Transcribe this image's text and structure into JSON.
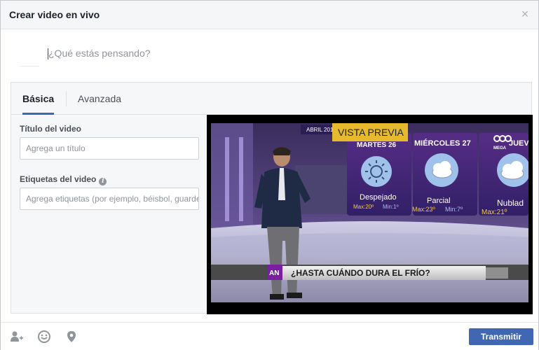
{
  "dialog": {
    "title": "Crear video en vivo",
    "close_glyph": "×"
  },
  "composer": {
    "placeholder": "¿Qué estás pensando?"
  },
  "tabs": [
    {
      "label": "Básica",
      "active": true
    },
    {
      "label": "Avanzada",
      "active": false
    }
  ],
  "form": {
    "title_label": "Título del video",
    "title_placeholder": "Agrega un título",
    "tags_label": "Etiquetas del video",
    "tags_placeholder": "Agrega etiquetas (por ejemplo, béisbol, guarde",
    "info_glyph": "i"
  },
  "preview": {
    "badge": "VISTA PREVIA",
    "month_tag": "ABRIL 201",
    "days": [
      {
        "name": "MARTES 26",
        "condition": "Despejado",
        "max": "Max:20º",
        "min": "Min:1º",
        "icon": "sun-icon"
      },
      {
        "name": "MIÉRCOLES 27",
        "condition": "Parcial",
        "max": "Max:23º",
        "min": "Min:7º",
        "icon": "partly-cloudy-icon"
      },
      {
        "name": "JUEVES",
        "condition": "Nublad",
        "max": "Max:21º",
        "min": "",
        "icon": "cloudy-icon"
      }
    ],
    "network": "MEGA",
    "ticker_logo": "AN",
    "ticker_text": "¿HASTA CUÁNDO DURA EL FRÍO?"
  },
  "footer": {
    "icons": [
      "tag-friends-icon",
      "emoji-icon",
      "location-pin-icon"
    ],
    "transmit_label": "Transmitir"
  },
  "colors": {
    "primary": "#4267b2",
    "badge_gold": "#e7b92c",
    "ticker_purple": "#7b1fa2"
  }
}
